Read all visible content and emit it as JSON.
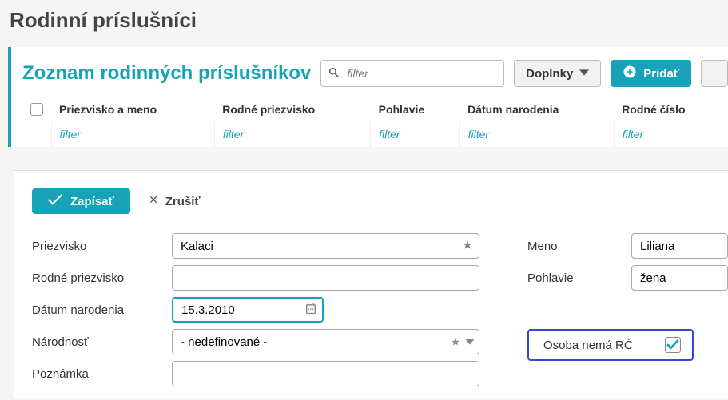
{
  "page_title": "Rodinní príslušníci",
  "panel": {
    "title": "Zoznam rodinných príslušníkov",
    "search_placeholder": "filter",
    "btn_addons": "Doplnky",
    "btn_add": "Pridať"
  },
  "table": {
    "headers": {
      "name": "Priezvisko a meno",
      "maiden": "Rodné priezvisko",
      "sex": "Pohlavie",
      "dob": "Dátum narodenia",
      "pid": "Rodné číslo"
    },
    "filter_label": "filter"
  },
  "form": {
    "btn_save": "Zapísať",
    "btn_cancel": "Zrušiť",
    "labels": {
      "surname": "Priezvisko",
      "maiden": "Rodné priezvisko",
      "dob": "Dátum narodenia",
      "nationality": "Národnosť",
      "note": "Poznámka",
      "firstname": "Meno",
      "sex": "Pohlavie",
      "no_pid": "Osoba nemá RČ"
    },
    "values": {
      "surname": "Kalaci",
      "maiden": "",
      "dob": "15.3.2010",
      "nationality": "- nedefinované -",
      "firstname": "Liliana",
      "sex": "žena",
      "no_pid_checked": true
    }
  }
}
